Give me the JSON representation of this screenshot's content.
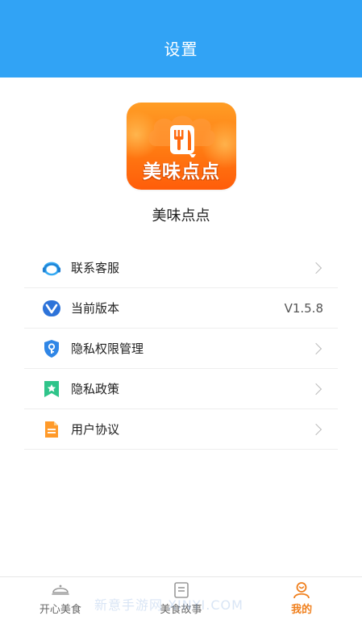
{
  "header": {
    "title": "设置"
  },
  "logo": {
    "text": "美味点点"
  },
  "app": {
    "name": "美味点点"
  },
  "menu": {
    "items": [
      {
        "label": "联系客服",
        "right": "",
        "icon": "customer-service-icon"
      },
      {
        "label": "当前版本",
        "right": "V1.5.8",
        "icon": "version-icon"
      },
      {
        "label": "隐私权限管理",
        "right": "",
        "icon": "privacy-shield-icon"
      },
      {
        "label": "隐私政策",
        "right": "",
        "icon": "policy-icon"
      },
      {
        "label": "用户协议",
        "right": "",
        "icon": "document-icon"
      }
    ]
  },
  "tabs": [
    {
      "label": "开心美食",
      "icon": "home-icon",
      "active": false
    },
    {
      "label": "美食故事",
      "icon": "story-icon",
      "active": false
    },
    {
      "label": "我的",
      "icon": "profile-icon",
      "active": true
    }
  ],
  "watermark": {
    "text": "新意手游网 XINYI.COM"
  },
  "colors": {
    "header": "#31a3f5",
    "accent": "#f0801e",
    "logo_orange": "#ff7a12"
  }
}
